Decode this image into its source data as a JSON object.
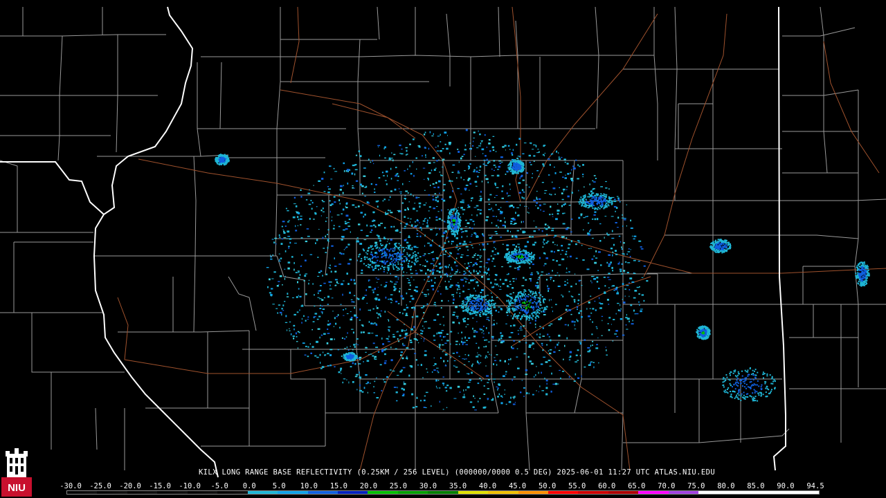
{
  "product": {
    "title": "KILX LONG RANGE BASE REFLECTIVITY (0.25KM / 256 LEVEL) (000000/0000 0.5 DEG) 2025-06-01 11:27 UTC  ATLAS.NIU.EDU",
    "station": "KILX",
    "timestamp": "2025-06-01 11:27 UTC",
    "source": "ATLAS.NIU.EDU"
  },
  "logo": {
    "text": "NIU",
    "icon": "castle-tower-icon",
    "color": "#c8102e"
  },
  "colors": {
    "background": "#000000",
    "county_lines": "#9a9a9a",
    "state_lines": "#ffffff",
    "roads": "#a0522d"
  },
  "scale": {
    "labels": [
      "-30.0",
      "-25.0",
      "-20.0",
      "-15.0",
      "-10.0",
      "-5.0",
      "0.0",
      "5.0",
      "10.0",
      "15.0",
      "20.0",
      "25.0",
      "30.0",
      "35.0",
      "40.0",
      "45.0",
      "50.0",
      "55.0",
      "60.0",
      "65.0",
      "70.0",
      "75.0",
      "80.0",
      "85.0",
      "90.0",
      "94.5"
    ],
    "colors": [
      "#000000",
      "#000000",
      "#000000",
      "#000000",
      "#000000",
      "#000000",
      "#1fb6d6",
      "#10a2e8",
      "#1060e0",
      "#0020c0",
      "#00c000",
      "#00a000",
      "#008000",
      "#e0e000",
      "#f0c000",
      "#ff9000",
      "#ff0000",
      "#d00000",
      "#b00000",
      "#ff00ff",
      "#a040e0",
      "#ffffff",
      "#ffffff",
      "#ffffff",
      "#ffffff"
    ]
  }
}
